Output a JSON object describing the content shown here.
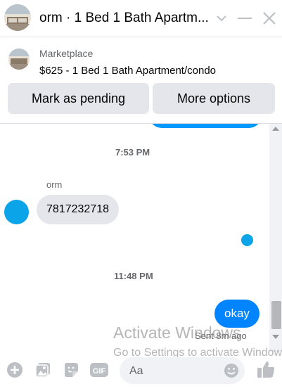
{
  "header": {
    "title": "orm · 1 Bed 1 Bath Apartm...",
    "avatar_icon": "apartment-photo-icon",
    "chevron_icon": "chevron-down-icon",
    "minimize_icon": "minimize-icon",
    "close_icon": "close-icon"
  },
  "marketplace": {
    "label": "Marketplace",
    "description": "$625 - 1 Bed 1 Bath Apartment/condo",
    "buttons": {
      "mark_pending": "Mark as pending",
      "more_options": "More options"
    }
  },
  "messages": {
    "timestamp_1": "7:53 PM",
    "sender_name": "orm",
    "incoming_text": "7817232718",
    "timestamp_2": "11:48 PM",
    "outgoing_text": "okay",
    "sent_status": "Sent 8m ago"
  },
  "watermark": {
    "line1": "Activate Windows",
    "line2": "Go to Settings to activate Windows."
  },
  "composer": {
    "placeholder": "Aa",
    "icons": [
      "plus-circle-icon",
      "photo-icon",
      "sticker-icon",
      "gif-icon",
      "emoji-icon",
      "thumbs-up-icon"
    ]
  },
  "colors": {
    "messenger_blue": "#0084ff",
    "seen_blue": "#0ba4e8",
    "icon_gray": "#bcc0c4",
    "bubble_gray": "#e4e6eb"
  }
}
